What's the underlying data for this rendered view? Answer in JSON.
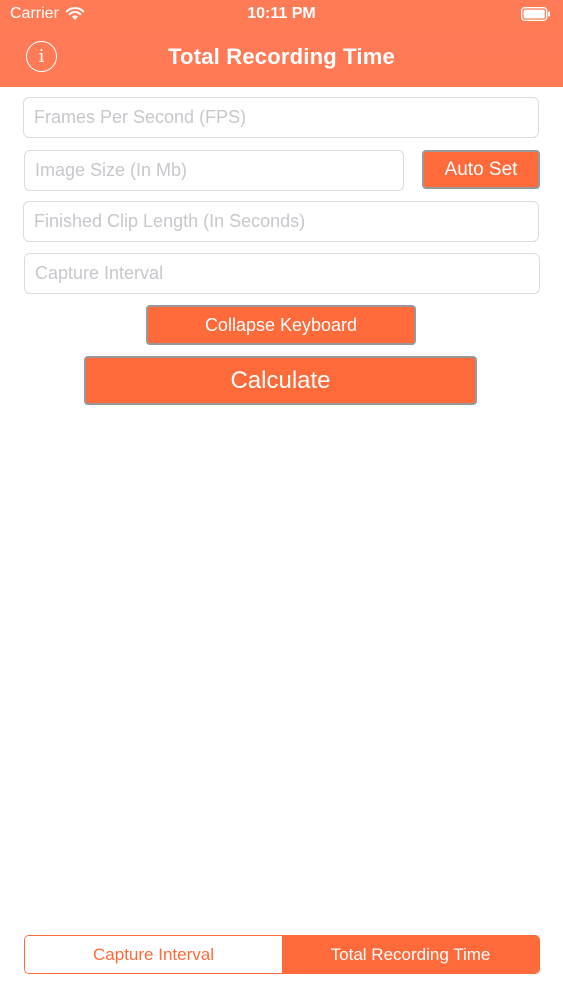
{
  "status_bar": {
    "carrier": "Carrier",
    "time": "10:11 PM"
  },
  "header": {
    "info_glyph": "i",
    "title": "Total Recording Time"
  },
  "form": {
    "fps": {
      "placeholder": "Frames Per Second (FPS)",
      "value": ""
    },
    "image_size": {
      "placeholder": "Image Size (In Mb)",
      "value": ""
    },
    "clip_length": {
      "placeholder": "Finished Clip Length (In Seconds)",
      "value": ""
    },
    "capture_interval": {
      "placeholder": "Capture Interval",
      "value": ""
    }
  },
  "buttons": {
    "auto_set": "Auto Set",
    "collapse_keyboard": "Collapse Keyboard",
    "calculate": "Calculate"
  },
  "segmented": {
    "options": [
      "Capture Interval",
      "Total Recording Time"
    ],
    "selected": "Total Recording Time"
  },
  "colors": {
    "accent": "#ff6a3a",
    "header": "#ff7a55"
  },
  "icons": {
    "wifi": "wifi-icon",
    "battery": "battery-icon",
    "info": "info-icon"
  }
}
